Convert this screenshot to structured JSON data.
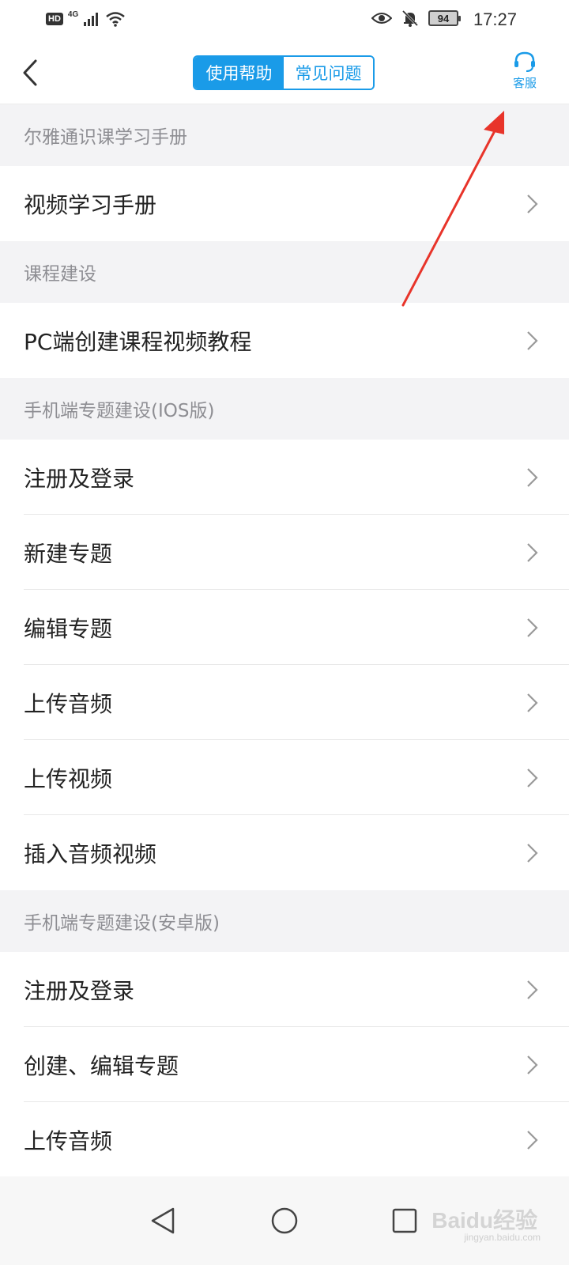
{
  "status_bar": {
    "hd_label": "HD",
    "network_label": "4G",
    "battery_level": "94",
    "time": "17:27"
  },
  "header": {
    "tabs": [
      {
        "label": "使用帮助",
        "active": true
      },
      {
        "label": "常见问题",
        "active": false
      }
    ],
    "service_label": "客服",
    "accent_color": "#1a9be8"
  },
  "sections": [
    {
      "title": "尔雅通识课学习手册",
      "items": [
        "视频学习手册"
      ]
    },
    {
      "title": "课程建设",
      "items": [
        "PC端创建课程视频教程"
      ]
    },
    {
      "title": "手机端专题建设(IOS版)",
      "items": [
        "注册及登录",
        "新建专题",
        "编辑专题",
        "上传音频",
        "上传视频",
        "插入音频视频"
      ]
    },
    {
      "title": "手机端专题建设(安卓版)",
      "items": [
        "注册及登录",
        "创建、编辑专题",
        "上传音频"
      ]
    }
  ],
  "annotation": {
    "color": "#e8342a"
  },
  "watermark": {
    "logo": "Baidu经验",
    "url": "jingyan.baidu.com"
  }
}
